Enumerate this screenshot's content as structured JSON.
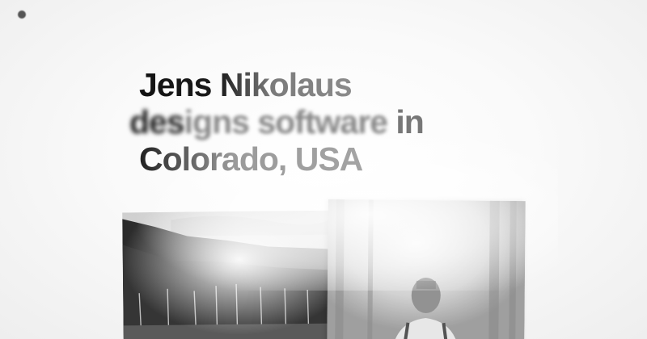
{
  "headline": {
    "line1": "Jens Nikolaus",
    "line2_a": "des",
    "line2_b": "igns softwa",
    "line2_c": "re",
    "line2_d": " in",
    "line3": "Colorado, USA"
  },
  "images": {
    "landscape_icon": "forest-landscape-photo",
    "portrait_icon": "person-in-forest-photo"
  },
  "colors": {
    "background": "#f7f7f7",
    "text_dark": "#111111",
    "text_light": "#9a9a9a"
  }
}
